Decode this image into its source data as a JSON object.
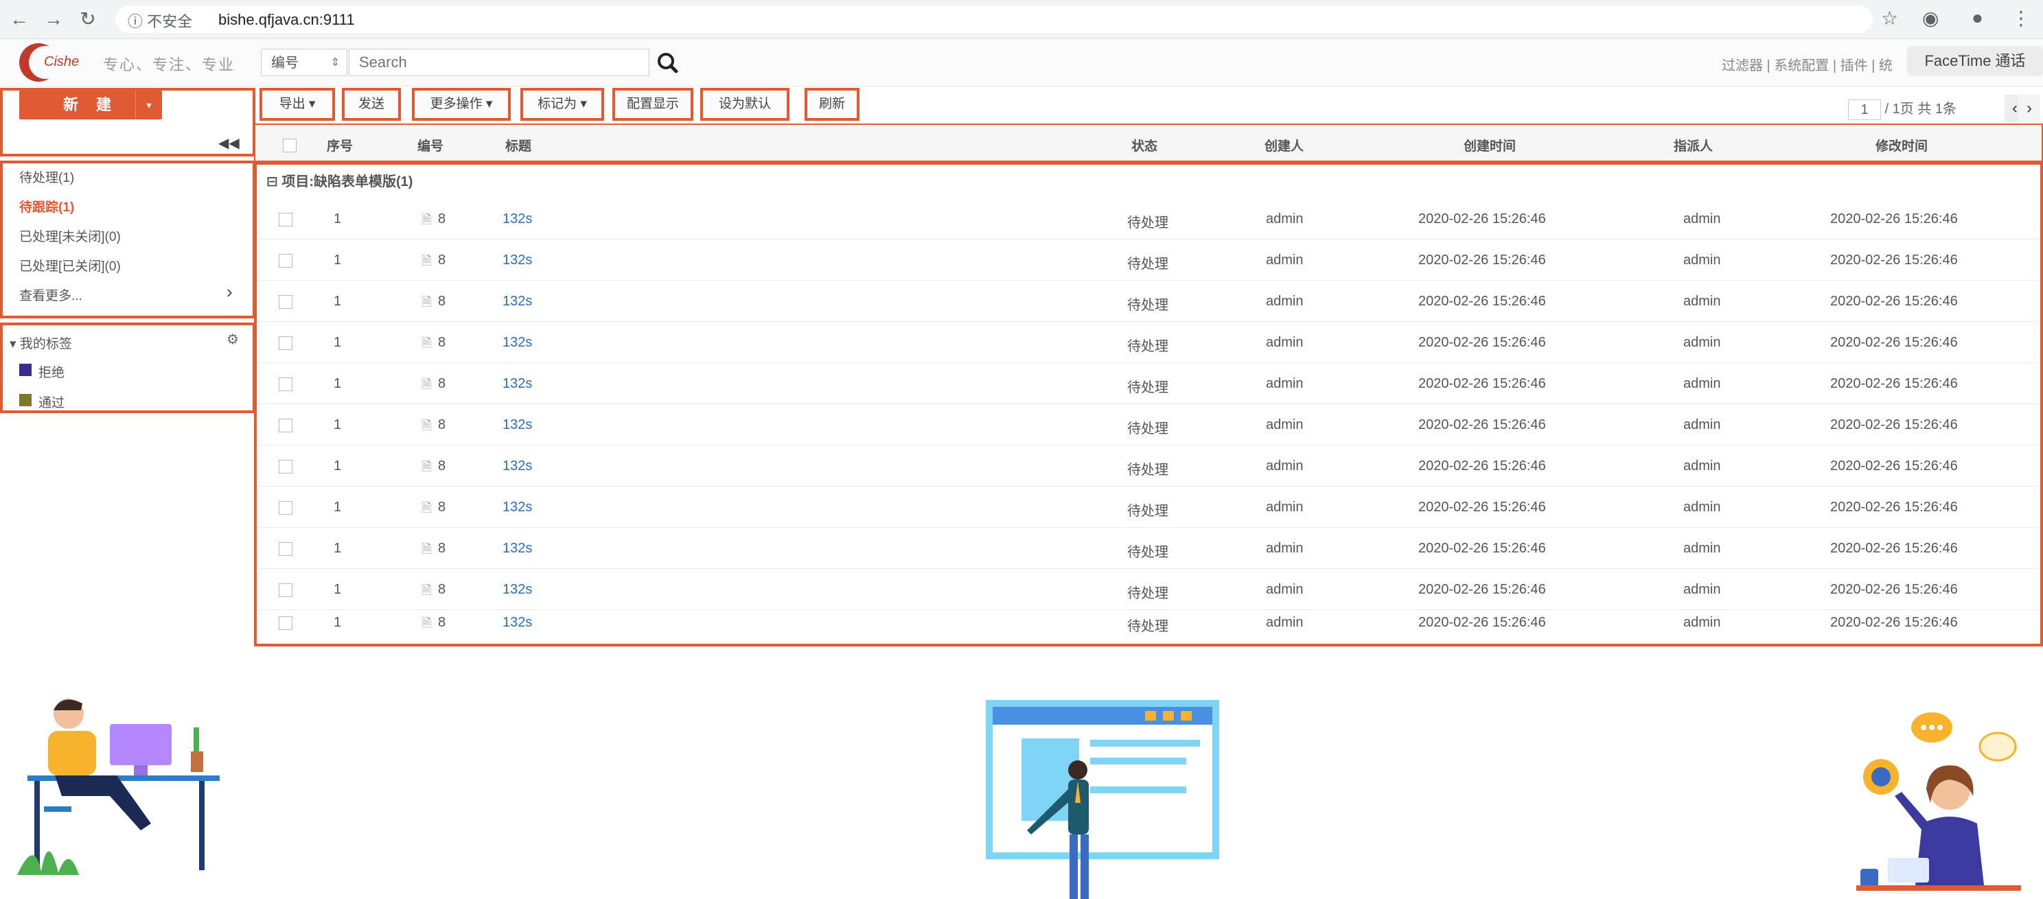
{
  "browser": {
    "security_label": "ⓘ 不安全",
    "url": "bishe.qfjava.cn:9111"
  },
  "header": {
    "logo_text": "Cishe",
    "slogan": "专心、专注、专业",
    "field_select": "编号",
    "search_placeholder": "Search",
    "top_links": "过滤器 | 系统配置 | 插件 | 统",
    "facetime_label": "FaceTime 通话"
  },
  "sidebar": {
    "new_button": "新 建",
    "items": [
      {
        "label": "待处理(1)",
        "active": false
      },
      {
        "label": "待跟踪(1)",
        "active": true
      },
      {
        "label": "已处理[未关闭](0)",
        "active": false
      },
      {
        "label": "已处理[已关闭](0)",
        "active": false
      },
      {
        "label": "查看更多...",
        "active": false
      }
    ],
    "tags_header": "我的标签",
    "tags": [
      {
        "label": "拒绝",
        "color": "#3d2a8a"
      },
      {
        "label": "通过",
        "color": "#7a7a2a"
      }
    ]
  },
  "toolbar": {
    "export": "导出 ▾",
    "send": "发送",
    "more_actions": "更多操作 ▾",
    "mark_as": "标记为 ▾",
    "config_display": "配置显示",
    "set_default": "设为默认",
    "refresh": "刷新"
  },
  "pager": {
    "page_value": "1",
    "page_text": "/ 1页 共 1条"
  },
  "table": {
    "columns": [
      "序号",
      "编号",
      "标题",
      "状态",
      "创建人",
      "创建时间",
      "指派人",
      "修改时间"
    ],
    "group_label": "项目:缺陷表单模版(1)",
    "rows": [
      {
        "index": "1",
        "code": "8",
        "title": "132s",
        "status": "待处理",
        "creator": "admin",
        "created": "2020-02-26 15:26:46",
        "assignee": "admin",
        "modified": "2020-02-26 15:26:46"
      },
      {
        "index": "1",
        "code": "8",
        "title": "132s",
        "status": "待处理",
        "creator": "admin",
        "created": "2020-02-26 15:26:46",
        "assignee": "admin",
        "modified": "2020-02-26 15:26:46"
      },
      {
        "index": "1",
        "code": "8",
        "title": "132s",
        "status": "待处理",
        "creator": "admin",
        "created": "2020-02-26 15:26:46",
        "assignee": "admin",
        "modified": "2020-02-26 15:26:46"
      },
      {
        "index": "1",
        "code": "8",
        "title": "132s",
        "status": "待处理",
        "creator": "admin",
        "created": "2020-02-26 15:26:46",
        "assignee": "admin",
        "modified": "2020-02-26 15:26:46"
      },
      {
        "index": "1",
        "code": "8",
        "title": "132s",
        "status": "待处理",
        "creator": "admin",
        "created": "2020-02-26 15:26:46",
        "assignee": "admin",
        "modified": "2020-02-26 15:26:46"
      },
      {
        "index": "1",
        "code": "8",
        "title": "132s",
        "status": "待处理",
        "creator": "admin",
        "created": "2020-02-26 15:26:46",
        "assignee": "admin",
        "modified": "2020-02-26 15:26:46"
      },
      {
        "index": "1",
        "code": "8",
        "title": "132s",
        "status": "待处理",
        "creator": "admin",
        "created": "2020-02-26 15:26:46",
        "assignee": "admin",
        "modified": "2020-02-26 15:26:46"
      },
      {
        "index": "1",
        "code": "8",
        "title": "132s",
        "status": "待处理",
        "creator": "admin",
        "created": "2020-02-26 15:26:46",
        "assignee": "admin",
        "modified": "2020-02-26 15:26:46"
      },
      {
        "index": "1",
        "code": "8",
        "title": "132s",
        "status": "待处理",
        "creator": "admin",
        "created": "2020-02-26 15:26:46",
        "assignee": "admin",
        "modified": "2020-02-26 15:26:46"
      },
      {
        "index": "1",
        "code": "8",
        "title": "132s",
        "status": "待处理",
        "creator": "admin",
        "created": "2020-02-26 15:26:46",
        "assignee": "admin",
        "modified": "2020-02-26 15:26:46"
      },
      {
        "index": "1",
        "code": "8",
        "title": "132s",
        "status": "待处理",
        "creator": "admin",
        "created": "2020-02-26 15:26:46",
        "assignee": "admin",
        "modified": "2020-02-26 15:26:46"
      }
    ]
  },
  "colors": {
    "accent": "#e05a33",
    "link": "#2a6ebb",
    "illustration_blue": "#7fd4f5"
  }
}
